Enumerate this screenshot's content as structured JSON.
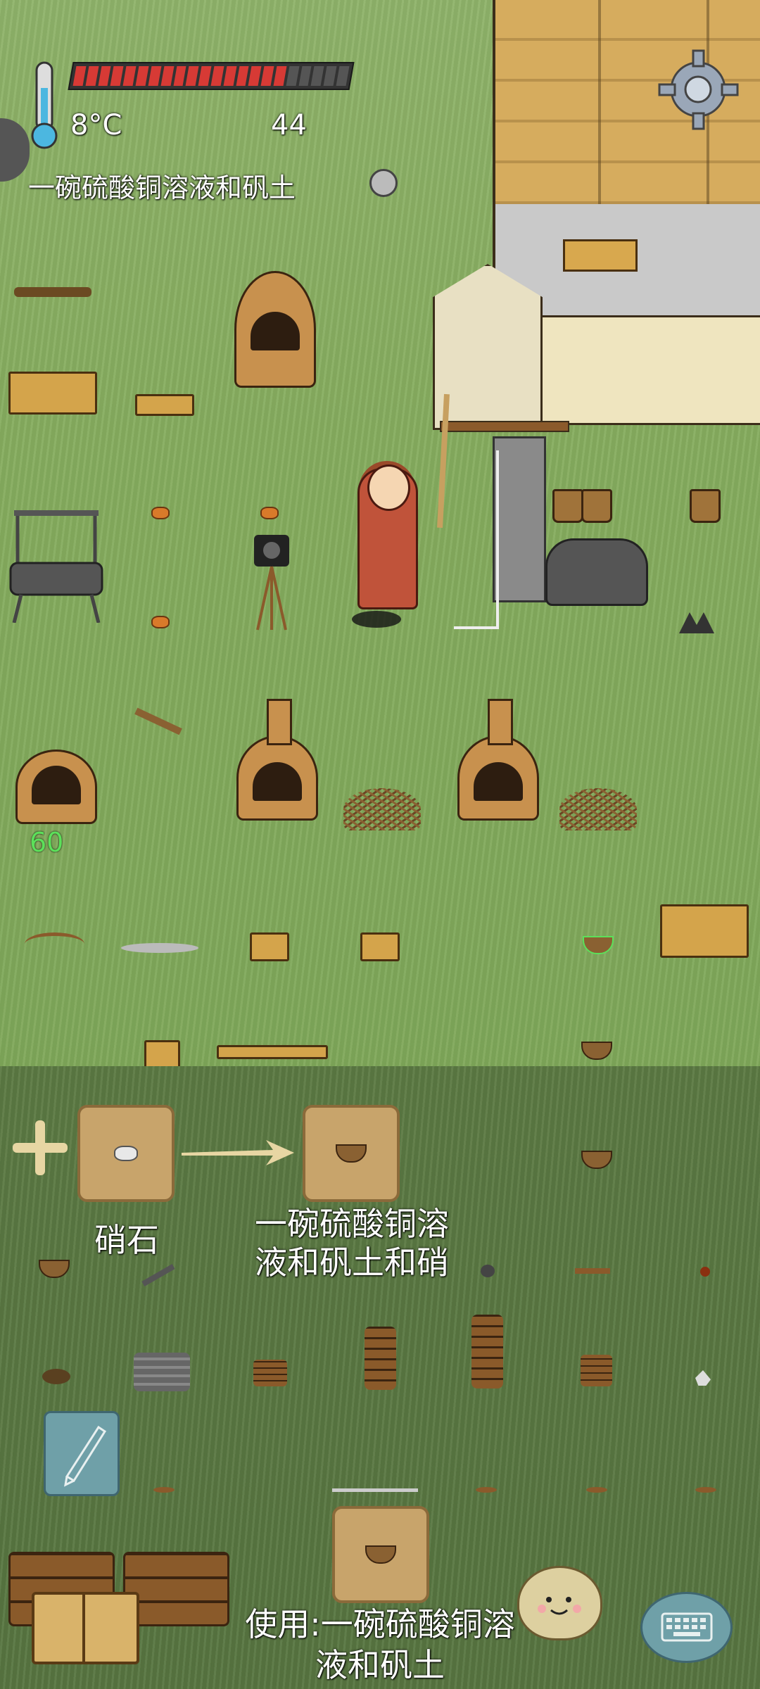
{
  "hud": {
    "temperature": "8°C",
    "food": "44",
    "hunger_fraction": 0.77,
    "held_item": "一碗硫酸铜溶液和矾土",
    "settings_icon": "gear-icon",
    "thermometer_icon": "thermometer-icon"
  },
  "world": {
    "hp_floating": "60"
  },
  "crafting": {
    "ingredient_name": "硝石",
    "result_name": "一碗硫酸铜溶液和矾土和硝",
    "use_label": "使用:一碗硫酸铜溶液和矾土"
  },
  "colors": {
    "hunger_fill": "#d73a35",
    "hp_text": "#5ce05a",
    "slot_bg": "#c8a46b"
  }
}
